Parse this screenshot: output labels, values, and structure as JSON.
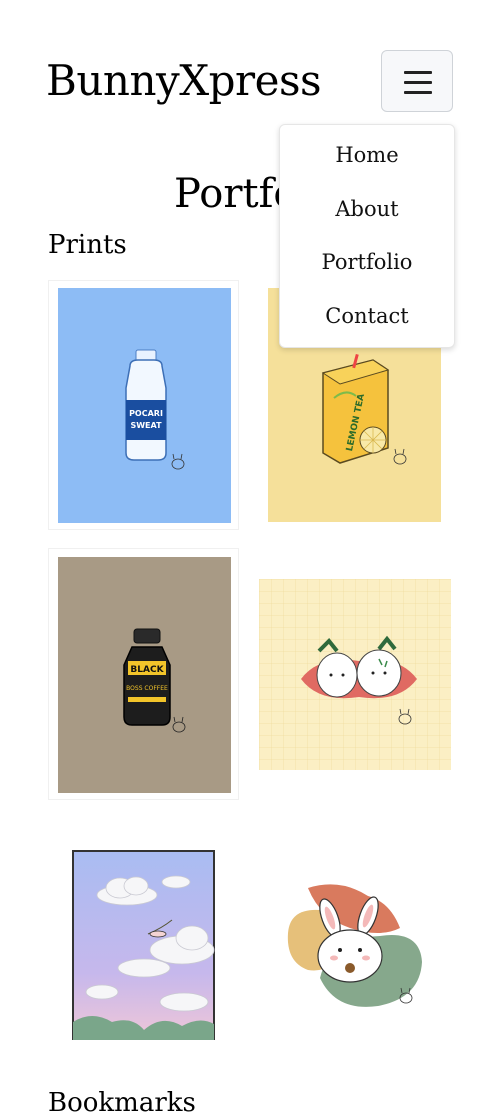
{
  "nav": {
    "brand": "BunnyXpress",
    "menu_items": [
      "Home",
      "About",
      "Portfolio",
      "Contact"
    ]
  },
  "page": {
    "title": "Portfolio"
  },
  "sections": {
    "prints": "Prints",
    "bookmarks": "Bookmarks"
  },
  "artwork_text": {
    "pocari_line1": "POCARI",
    "pocari_line2": "SWEAT",
    "lemon_tea": "LEMON TEA",
    "boss_black": "BLACK",
    "boss_coffee": "BOSS COFFEE"
  },
  "colors": {
    "pocari_bg": "#8dbcf5",
    "lemon_bg": "#f5e09a",
    "boss_bg": "#a89a85",
    "grid_bg": "#fbefc4"
  }
}
